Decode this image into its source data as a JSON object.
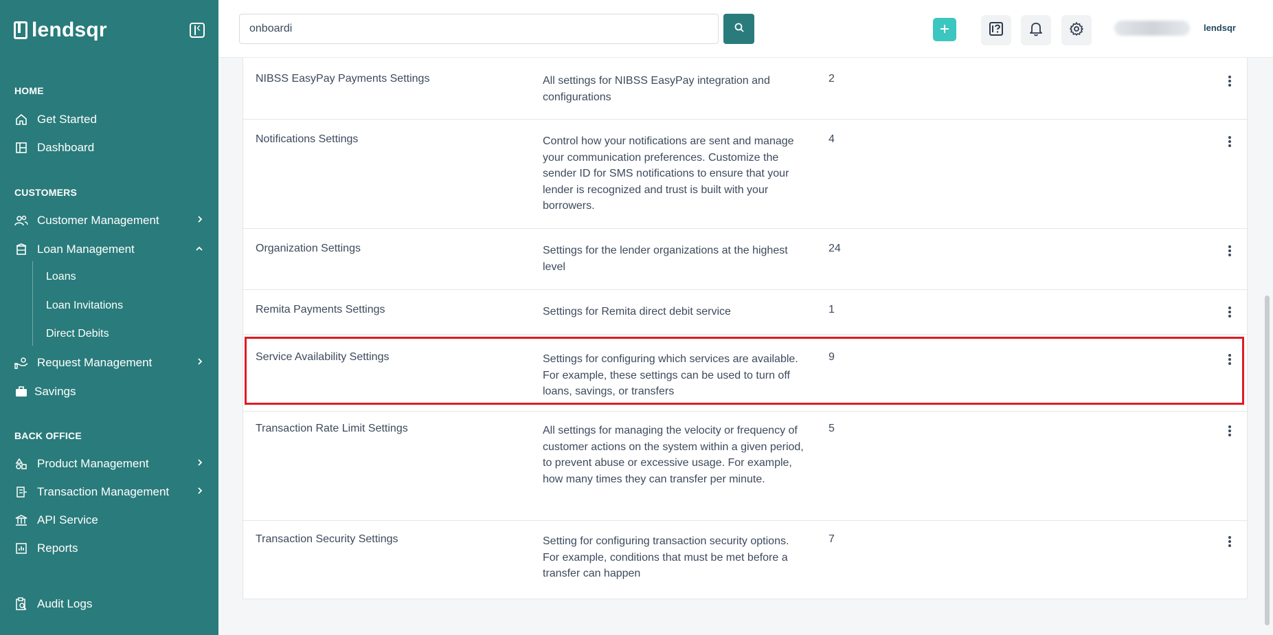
{
  "sidebar": {
    "brand": "lendsqr",
    "sections": {
      "home": "HOME",
      "customers": "CUSTOMERS",
      "back_office": "BACK OFFICE"
    },
    "items": {
      "get_started": "Get Started",
      "dashboard": "Dashboard",
      "customer_management": "Customer Management",
      "loan_management": "Loan Management",
      "loans": "Loans",
      "loan_invitations": "Loan Invitations",
      "direct_debits": "Direct Debits",
      "request_management": "Request Management",
      "savings": "Savings",
      "product_management": "Product Management",
      "transaction_management": "Transaction Management",
      "api_service": "API Service",
      "reports": "Reports",
      "audit_logs": "Audit Logs"
    }
  },
  "header": {
    "search_value": "onboardi",
    "brand_small": "lendsqr",
    "icons": [
      "search-icon",
      "plus-icon",
      "help-icon",
      "bell-icon",
      "gear-icon"
    ]
  },
  "table": {
    "rows": [
      {
        "name": "NIBSS EasyPay Payments Settings",
        "description": "All settings for NIBSS EasyPay integration and configurations",
        "count": "2"
      },
      {
        "name": "Notifications Settings",
        "description": "Control how your notifications are sent and manage your communication preferences. Customize the sender ID for SMS notifications to ensure that your lender is recognized and trust is built with your borrowers.",
        "count": "4"
      },
      {
        "name": "Organization Settings",
        "description": "Settings for the lender organizations at the highest level",
        "count": "24"
      },
      {
        "name": "Remita Payments Settings",
        "description": "Settings for Remita direct debit service",
        "count": "1"
      },
      {
        "name": "Service Availability Settings",
        "description": "Settings for configuring which services are available. For example, these settings can be used to turn off loans, savings, or transfers",
        "count": "9"
      },
      {
        "name": "Transaction Rate Limit Settings",
        "description": "All settings for managing the velocity or frequency of customer actions on the system within a given period, to prevent abuse or excessive usage. For example, how many times they can transfer per minute.",
        "count": "5"
      },
      {
        "name": "Transaction Security Settings",
        "description": "Setting for configuring transaction security options. For example, conditions that must be met before a transfer can happen",
        "count": "7"
      }
    ]
  },
  "colors": {
    "sidebar": "#2a7b7b",
    "accent": "#3cc6c0",
    "highlight": "#e01b24"
  }
}
